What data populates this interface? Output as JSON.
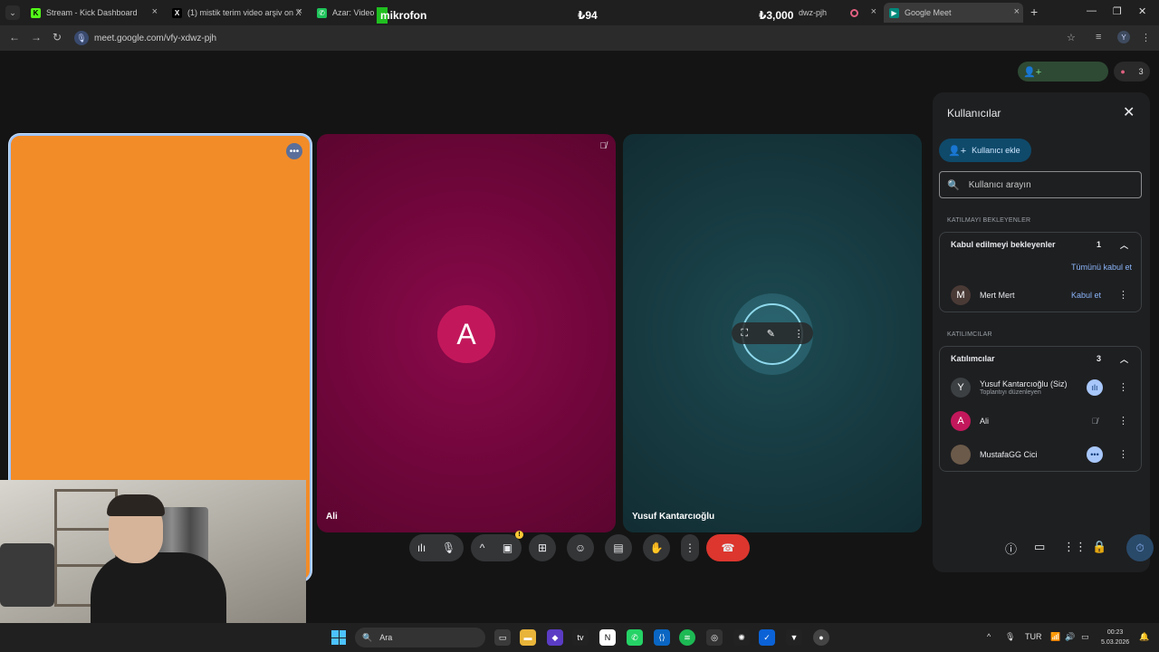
{
  "browser": {
    "tabs": [
      {
        "title": "Stream - Kick Dashboard",
        "icon": "kick-icon",
        "color": "#53fc18"
      },
      {
        "title": "(1) mistik terim video arşiv on X",
        "icon": "x-icon",
        "color": "#000000"
      },
      {
        "title": "Azar: Video Ch",
        "icon": "azar-icon",
        "color": "#1ec35a"
      },
      {
        "title": "dwz-pjh",
        "icon": "meet-record-icon",
        "color": "#e06080"
      },
      {
        "title": "Google Meet",
        "icon": "google-meet-icon",
        "color": "#00897b"
      }
    ],
    "overlay": {
      "mic_label": "mikrofon",
      "balance_1": "₺94",
      "balance_2": "₺3,000"
    },
    "url": "meet.google.com/vfy-xdwz-pjh",
    "profile_initial": "Y"
  },
  "meet": {
    "people_count": "3",
    "tiles": [
      {
        "name": "",
        "color": "#f28c28"
      },
      {
        "name": "Ali",
        "avatar": "A",
        "color": "#6e063a"
      },
      {
        "name": "Yusuf Kantarcıoğlu",
        "color": "#16383e"
      }
    ]
  },
  "panel": {
    "title": "Kullanıcılar",
    "add_button": "Kullanıcı ekle",
    "search_placeholder": "Kullanıcı arayın",
    "waiting_section": "KATILMAYI BEKLEYENLER",
    "waiting_group": {
      "title": "Kabul edilmeyi bekleyenler",
      "count": "1",
      "accept_all": "Tümünü kabul et"
    },
    "waiting_member": {
      "initial": "M",
      "name": "Mert Mert",
      "action": "Kabul et"
    },
    "participants_section": "KATILIMCILAR",
    "participants_group": {
      "title": "Katılımcılar",
      "count": "3"
    },
    "participants": [
      {
        "initial": "Y",
        "name": "Yusuf Kantarcıoğlu (Siz)",
        "subtitle": "Toplantıyı düzenleyen",
        "avatar_color": "#3c4043"
      },
      {
        "initial": "A",
        "name": "Ali",
        "subtitle": "",
        "avatar_color": "#c2185b"
      },
      {
        "initial": "",
        "name": "MustafaGG Cici",
        "subtitle": "",
        "avatar_color": "#6b5a4a"
      }
    ]
  },
  "taskbar": {
    "search": "Ara",
    "language": "TUR",
    "time": "00:23",
    "date": "5.03.2026"
  }
}
